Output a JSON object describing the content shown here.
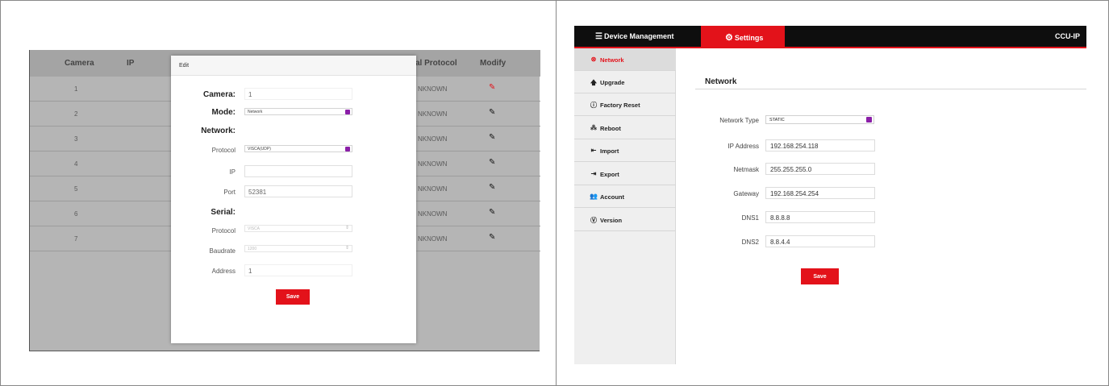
{
  "camera_list": {
    "columns": [
      "Camera",
      "IP",
      "al Protocol",
      "Modify"
    ],
    "rows": [
      {
        "camera": "1",
        "protocol": "NKNOWN"
      },
      {
        "camera": "2",
        "protocol": "NKNOWN"
      },
      {
        "camera": "3",
        "protocol": "NKNOWN"
      },
      {
        "camera": "4",
        "protocol": "NKNOWN"
      },
      {
        "camera": "5",
        "protocol": "NKNOWN"
      },
      {
        "camera": "6",
        "protocol": "NKNOWN"
      },
      {
        "camera": "7",
        "protocol": "NKNOWN"
      }
    ],
    "modify_icon": "pencil-icon",
    "highlight_color": "#e3121a"
  },
  "edit_modal": {
    "title": "Edit",
    "camera_label": "Camera:",
    "camera_value": "1",
    "mode_label": "Mode:",
    "mode_value": "Network",
    "network_section": "Network:",
    "protocol_label": "Protocol",
    "protocol_value": "VISCA(UDP)",
    "ip_label": "IP",
    "ip_value": "",
    "port_label": "Port",
    "port_value": "52381",
    "serial_section": "Serial:",
    "serial_protocol_label": "Protocol",
    "serial_protocol_value": "VISCA",
    "baudrate_label": "Baudrate",
    "baudrate_value": "1200",
    "address_label": "Address",
    "address_value": "1",
    "save_label": "Save"
  },
  "settings_app": {
    "tabs": {
      "device_management": "Device Management",
      "settings": "Settings",
      "product": "CCU-IP"
    },
    "accent_color": "#e3121a",
    "sidebar": [
      {
        "label": "Network",
        "icon": "network-icon"
      },
      {
        "label": "Upgrade",
        "icon": "upload-arrow-icon"
      },
      {
        "label": "Factory Reset",
        "icon": "info-icon"
      },
      {
        "label": "Reboot",
        "icon": "reboot-icon"
      },
      {
        "label": "Import",
        "icon": "import-icon"
      },
      {
        "label": "Export",
        "icon": "export-icon"
      },
      {
        "label": "Account",
        "icon": "users-icon"
      },
      {
        "label": "Version",
        "icon": "version-icon"
      }
    ],
    "content": {
      "title": "Network",
      "network_type_label": "Network Type",
      "network_type_value": "STATIC",
      "ip_label": "IP Address",
      "ip_value": "192.168.254.118",
      "netmask_label": "Netmask",
      "netmask_value": "255.255.255.0",
      "gateway_label": "Gateway",
      "gateway_value": "192.168.254.254",
      "dns1_label": "DNS1",
      "dns1_value": "8.8.8.8",
      "dns2_label": "DNS2",
      "dns2_value": "8.8.4.4",
      "save_label": "Save"
    }
  }
}
